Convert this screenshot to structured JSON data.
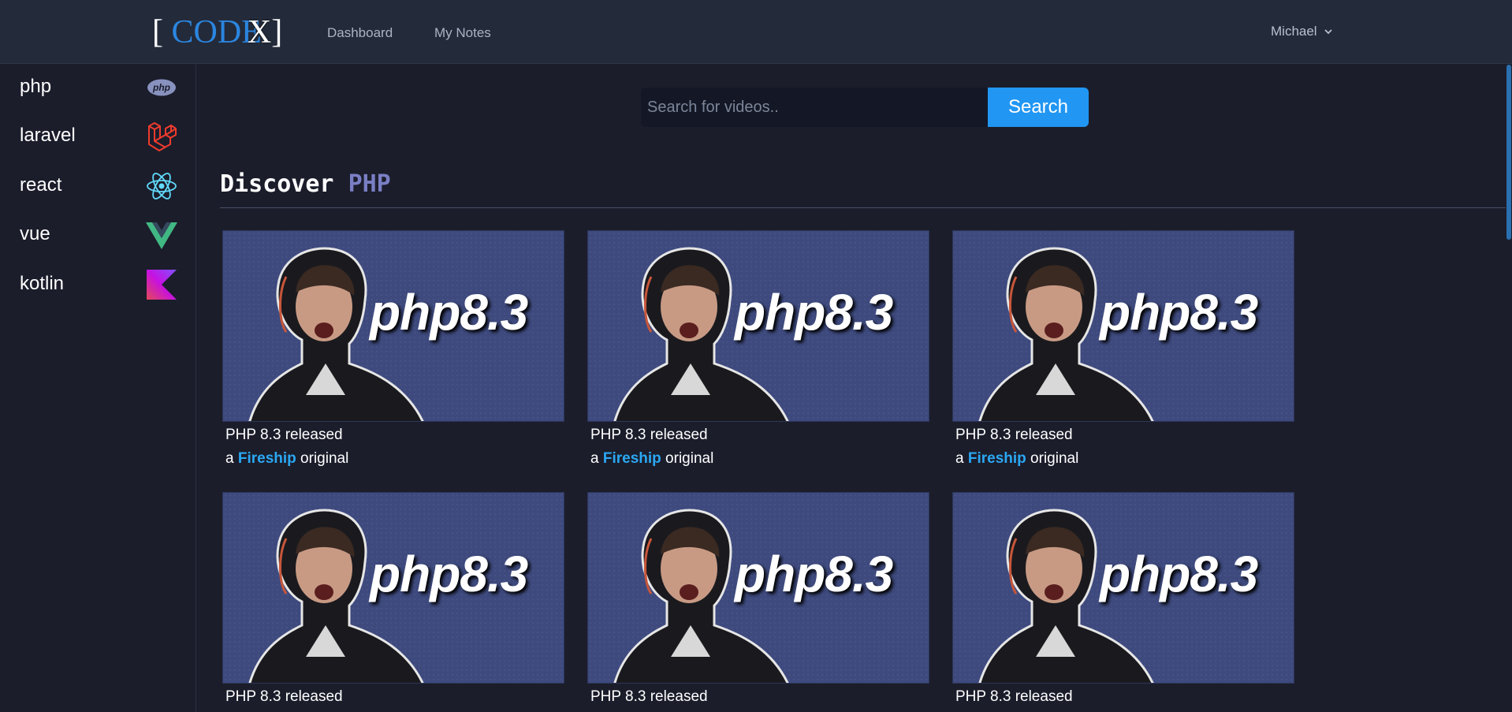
{
  "header": {
    "logo_open": "[",
    "logo_code": "CODE",
    "logo_x": "X",
    "logo_close": "]",
    "nav": [
      "Dashboard",
      "My Notes"
    ],
    "user_name": "Michael"
  },
  "sidebar": {
    "items": [
      {
        "label": "php",
        "icon": "php-icon"
      },
      {
        "label": "laravel",
        "icon": "laravel-icon"
      },
      {
        "label": "react",
        "icon": "react-icon"
      },
      {
        "label": "vue",
        "icon": "vue-icon"
      },
      {
        "label": "kotlin",
        "icon": "kotlin-icon"
      }
    ]
  },
  "search": {
    "placeholder": "Search for videos..",
    "button_label": "Search"
  },
  "discover": {
    "prefix": "Discover",
    "language": "PHP"
  },
  "videos": [
    {
      "title": "PHP 8.3 released",
      "sub_prefix": "a",
      "author": "Fireship",
      "sub_suffix": "original",
      "thumb_text": "php8.3"
    },
    {
      "title": "PHP 8.3 released",
      "sub_prefix": "a",
      "author": "Fireship",
      "sub_suffix": "original",
      "thumb_text": "php8.3"
    },
    {
      "title": "PHP 8.3 released",
      "sub_prefix": "a",
      "author": "Fireship",
      "sub_suffix": "original",
      "thumb_text": "php8.3"
    },
    {
      "title": "PHP 8.3 released",
      "thumb_text": "php8.3"
    },
    {
      "title": "PHP 8.3 released",
      "thumb_text": "php8.3"
    },
    {
      "title": "PHP 8.3 released",
      "thumb_text": "php8.3"
    }
  ],
  "colors": {
    "accent": "#2196f3",
    "author": "#2ba8f4",
    "php_purple": "#7a7fc4",
    "background": "#1b1d2b",
    "topbar": "#232a3a"
  }
}
